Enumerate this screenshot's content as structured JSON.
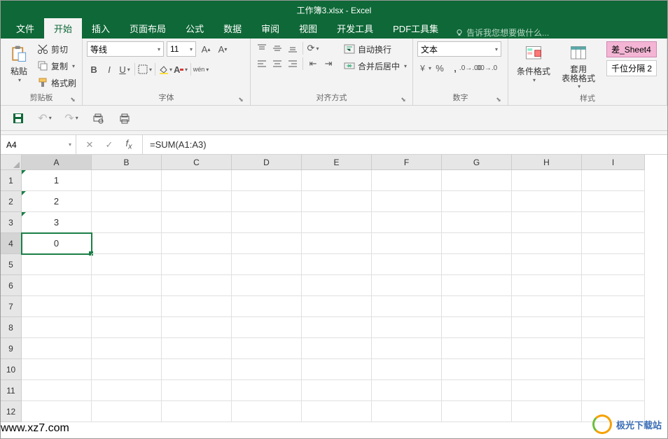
{
  "title": "工作簿3.xlsx - Excel",
  "tabs": {
    "file": "文件",
    "home": "开始",
    "insert": "插入",
    "pagelayout": "页面布局",
    "formulas": "公式",
    "data": "数据",
    "review": "审阅",
    "view": "视图",
    "developer": "开发工具",
    "pdf": "PDF工具集"
  },
  "tellme": "告诉我您想要做什么...",
  "clipboard": {
    "paste": "粘贴",
    "cut": "剪切",
    "copy": "复制",
    "format_painter": "格式刷",
    "group": "剪贴板"
  },
  "font": {
    "name": "等线",
    "size": "11",
    "group": "字体"
  },
  "align": {
    "wrap": "自动换行",
    "merge": "合并后居中",
    "group": "对齐方式"
  },
  "number": {
    "format": "文本",
    "group": "数字"
  },
  "styles": {
    "cond": "条件格式",
    "table": "套用\n表格格式",
    "diff": "差_Sheet4",
    "thousand": "千位分隔 2",
    "group": "样式"
  },
  "namebox": "A4",
  "formula": "=SUM(A1:A3)",
  "cols": [
    "A",
    "B",
    "C",
    "D",
    "E",
    "F",
    "G",
    "H",
    "I"
  ],
  "rows": [
    "1",
    "2",
    "3",
    "4",
    "5",
    "6",
    "7",
    "8",
    "9",
    "10",
    "11",
    "12"
  ],
  "cells": {
    "A1": "1",
    "A2": "2",
    "A3": "3",
    "A4": "0"
  },
  "watermark": {
    "name": "极光下载站",
    "url": "www.xz7.com"
  }
}
